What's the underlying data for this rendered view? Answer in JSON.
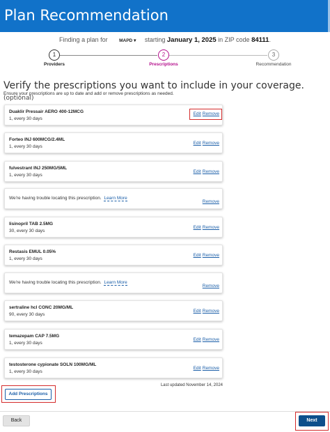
{
  "header": {
    "title": "Plan Recommendation"
  },
  "finder": {
    "prefix": "Finding a plan for",
    "plan_type": "MAPD",
    "plan_caret": "▾",
    "starting_label": "starting",
    "start_date": "January 1, 2025",
    "zip_label": "in ZIP code",
    "zip": "84111",
    "end": "."
  },
  "stepper": {
    "steps": [
      {
        "number": "1",
        "label": "Providers",
        "state": "complete"
      },
      {
        "number": "2",
        "label": "Prescriptions",
        "state": "active"
      },
      {
        "number": "3",
        "label": "Recommendation",
        "state": "inactive"
      }
    ]
  },
  "page": {
    "heading": "Verify the prescriptions you want to include in your coverage.",
    "optional": "(optional)",
    "subheading": "Ensure your prescriptions are up to date and add or remove prescriptions as needed."
  },
  "actions": {
    "edit": "Edit",
    "remove": "Remove",
    "learn_more": "Learn More"
  },
  "prescriptions": [
    {
      "name": "Duaklir Pressair AERO 400-12MCG",
      "qty": "1, every 30 days"
    },
    {
      "name": "Forteo INJ 600MCG/2.4ML",
      "qty": "1, every 30 days"
    },
    {
      "name": "fulvestrant INJ 250MG/5ML",
      "qty": "1, every 30 days"
    },
    {
      "message": "We're having trouble locating this prescription."
    },
    {
      "name": "lisinopril TAB 2.5MG",
      "qty": "30, every 30 days"
    },
    {
      "name": "Restasis EMUL 0.05%",
      "qty": "1, every 30 days"
    },
    {
      "message": "We're having trouble locating this prescription."
    },
    {
      "name": "sertraline hcl CONC 20MG/ML",
      "qty": "90, every 30 days"
    },
    {
      "name": "temazepam CAP 7.5MG",
      "qty": "1, every 30 days"
    },
    {
      "name": "testosterone cypionate SOLN 100MG/ML",
      "qty": "1, every 30 days"
    }
  ],
  "last_updated": "Last updated November 14, 2024",
  "buttons": {
    "add": "Add Prescriptions",
    "back": "Back",
    "next": "Next"
  },
  "colors": {
    "header_bg": "#1172c9",
    "active_step": "#b40f8c",
    "link": "#1a5ea8",
    "next_bg": "#0d4f8b",
    "highlight": "#d42a2a"
  }
}
